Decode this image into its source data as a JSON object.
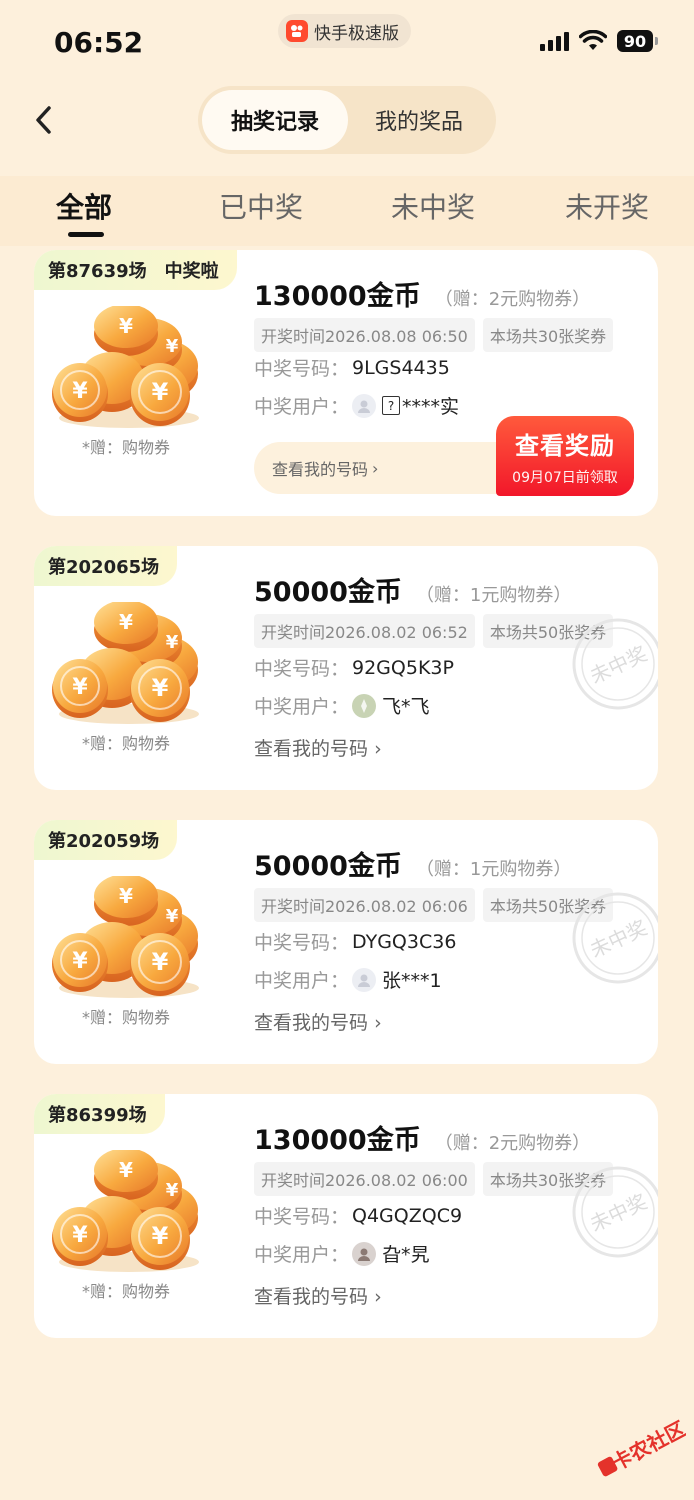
{
  "status": {
    "time": "06:52",
    "app_name": "快手极速版",
    "battery": "90"
  },
  "header": {
    "segments": [
      {
        "label": "抽奖记录",
        "active": true
      },
      {
        "label": "我的奖品",
        "active": false
      }
    ]
  },
  "filters": [
    {
      "label": "全部",
      "active": true
    },
    {
      "label": "已中奖",
      "active": false
    },
    {
      "label": "未中奖",
      "active": false
    },
    {
      "label": "未开奖",
      "active": false
    }
  ],
  "labels": {
    "winning_number": "中奖号码：",
    "winning_user": "中奖用户：",
    "gift_caption": "*赠：购物券",
    "view_numbers": "查看我的号码",
    "chevron": "›"
  },
  "records": [
    {
      "round": "第87639场",
      "badge": "中奖啦",
      "prize": "130000金币",
      "gift": "（赠：2元购物券）",
      "draw_time": "开奖时间2026.08.08 06:50",
      "ticket_count": "本场共30张奖券",
      "winning_number": "9LGS4435",
      "winner": "****实",
      "winner_prefix": "?",
      "reward_button": "查看奖励",
      "reward_deadline": "09月07日前领取"
    },
    {
      "round": "第202065场",
      "prize": "50000金币",
      "gift": "（赠：1元购物券）",
      "draw_time": "开奖时间2026.08.02 06:52",
      "ticket_count": "本场共50张奖券",
      "winning_number": "92GQ5K3P",
      "winner": "飞*飞",
      "stamp": "未中奖"
    },
    {
      "round": "第202059场",
      "prize": "50000金币",
      "gift": "（赠：1元购物券）",
      "draw_time": "开奖时间2026.08.02 06:06",
      "ticket_count": "本场共50张奖券",
      "winning_number": "DYGQ3C36",
      "winner": "张***1",
      "stamp": "未中奖"
    },
    {
      "round": "第86399场",
      "prize": "130000金币",
      "gift": "（赠：2元购物券）",
      "draw_time": "开奖时间2026.08.02 06:00",
      "ticket_count": "本场共30张奖券",
      "winning_number": "Q4GQZQC9",
      "winner": "旮*旯",
      "stamp": "未中奖"
    }
  ],
  "watermark": "卡农社区",
  "colors": {
    "background": "#fdf0dc",
    "accent_red": "#f2172a",
    "coin_gold": "#f5a23a"
  }
}
